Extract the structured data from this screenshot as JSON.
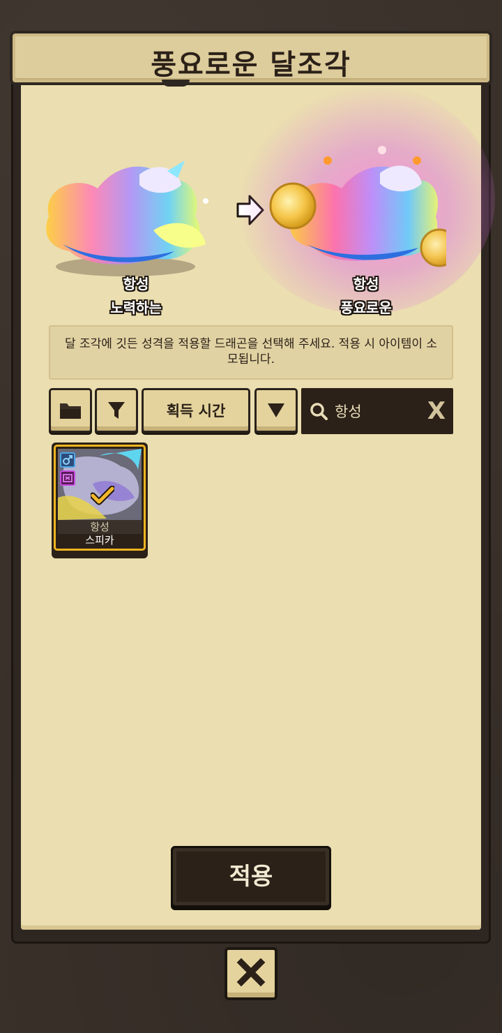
{
  "title": "풍요로운 달조각",
  "preview": {
    "before": {
      "line1": "항성",
      "line2": "노력하는"
    },
    "after": {
      "line1": "항성",
      "line2": "풍요로운"
    }
  },
  "info_text": "달 조각에 깃든 성격을 적용할 드래곤을 선택해 주세요. 적용 시 아이템이 소모됩니다.",
  "toolbar": {
    "folder_icon": "folder-icon",
    "filter_icon": "filter-icon",
    "sort_label": "획득 시간",
    "order_icon": "triangle-down-icon"
  },
  "search": {
    "value": "항성",
    "clear_label": "X"
  },
  "dragons": [
    {
      "line1": "항성",
      "line2": "스피카",
      "selected": true
    }
  ],
  "apply_label": "적용",
  "colors": {
    "parchment": "#ebdeb0",
    "dark": "#2b2118",
    "selected_border": "#f0b41e",
    "button": "#e4d39d"
  }
}
